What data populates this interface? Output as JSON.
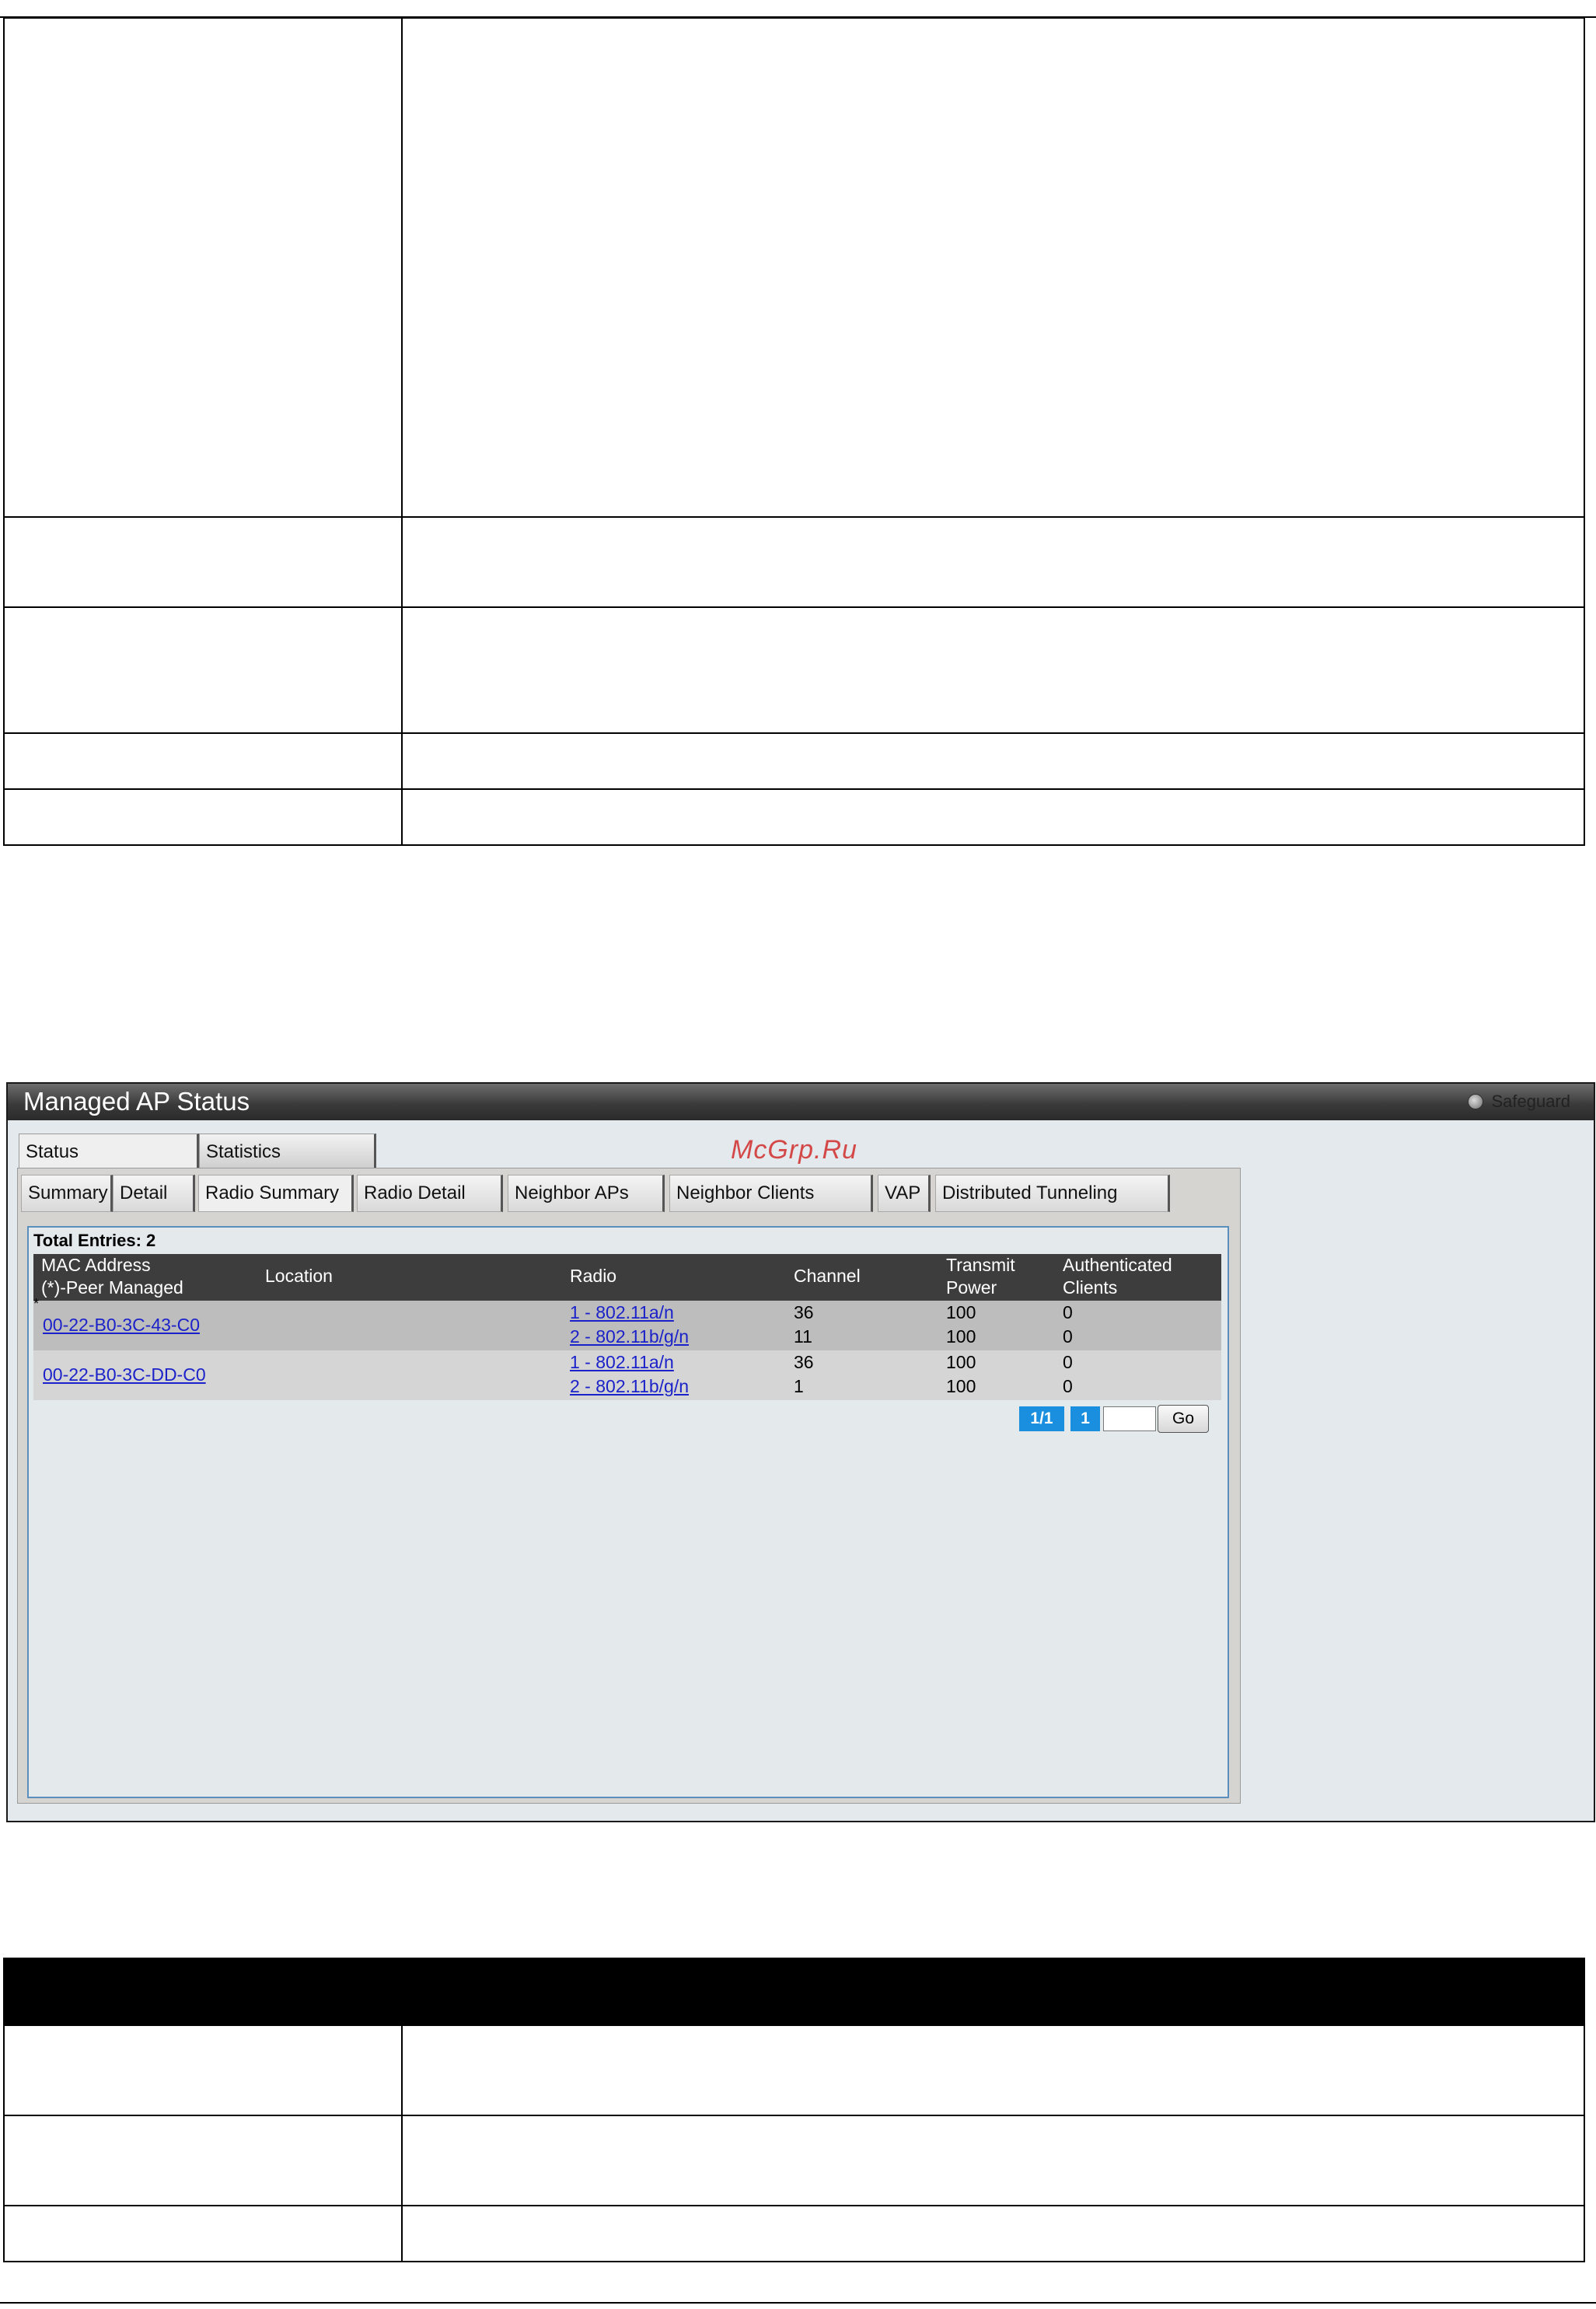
{
  "panel": {
    "title": "Managed AP Status",
    "safeguard_label": "Safeguard",
    "watermark": "McGrp.Ru"
  },
  "tabs": {
    "top": [
      {
        "label": "Status"
      },
      {
        "label": "Statistics"
      }
    ],
    "sub": [
      {
        "label": "Summary"
      },
      {
        "label": "Detail"
      },
      {
        "label": "Radio Summary"
      },
      {
        "label": "Radio Detail"
      },
      {
        "label": "Neighbor APs"
      },
      {
        "label": "Neighbor Clients"
      },
      {
        "label": "VAP"
      },
      {
        "label": "Distributed Tunneling"
      }
    ]
  },
  "table": {
    "total_entries": "Total Entries: 2",
    "headers": {
      "mac_line1": "MAC Address",
      "mac_line2": "(*)-Peer Managed",
      "location": "Location",
      "radio": "Radio",
      "channel": "Channel",
      "power_line1": "Transmit",
      "power_line2": "Power",
      "auth_line1": "Authenticated",
      "auth_line2": "Clients"
    },
    "rows": [
      {
        "peer_marker": "*",
        "mac": "00-22-B0-3C-43-C0",
        "location": "",
        "radios": [
          "1 - 802.11a/n",
          "2 - 802.11b/g/n"
        ],
        "channels": [
          "36",
          "11"
        ],
        "powers": [
          "100",
          "100"
        ],
        "clients": [
          "0",
          "0"
        ]
      },
      {
        "peer_marker": "",
        "mac": "00-22-B0-3C-DD-C0",
        "location": "",
        "radios": [
          "1 - 802.11a/n",
          "2 - 802.11b/g/n"
        ],
        "channels": [
          "36",
          "1"
        ],
        "powers": [
          "100",
          "100"
        ],
        "clients": [
          "0",
          "0"
        ]
      }
    ]
  },
  "pager": {
    "page_of": "1/1",
    "current": "1",
    "input_value": "",
    "go_label": "Go"
  }
}
